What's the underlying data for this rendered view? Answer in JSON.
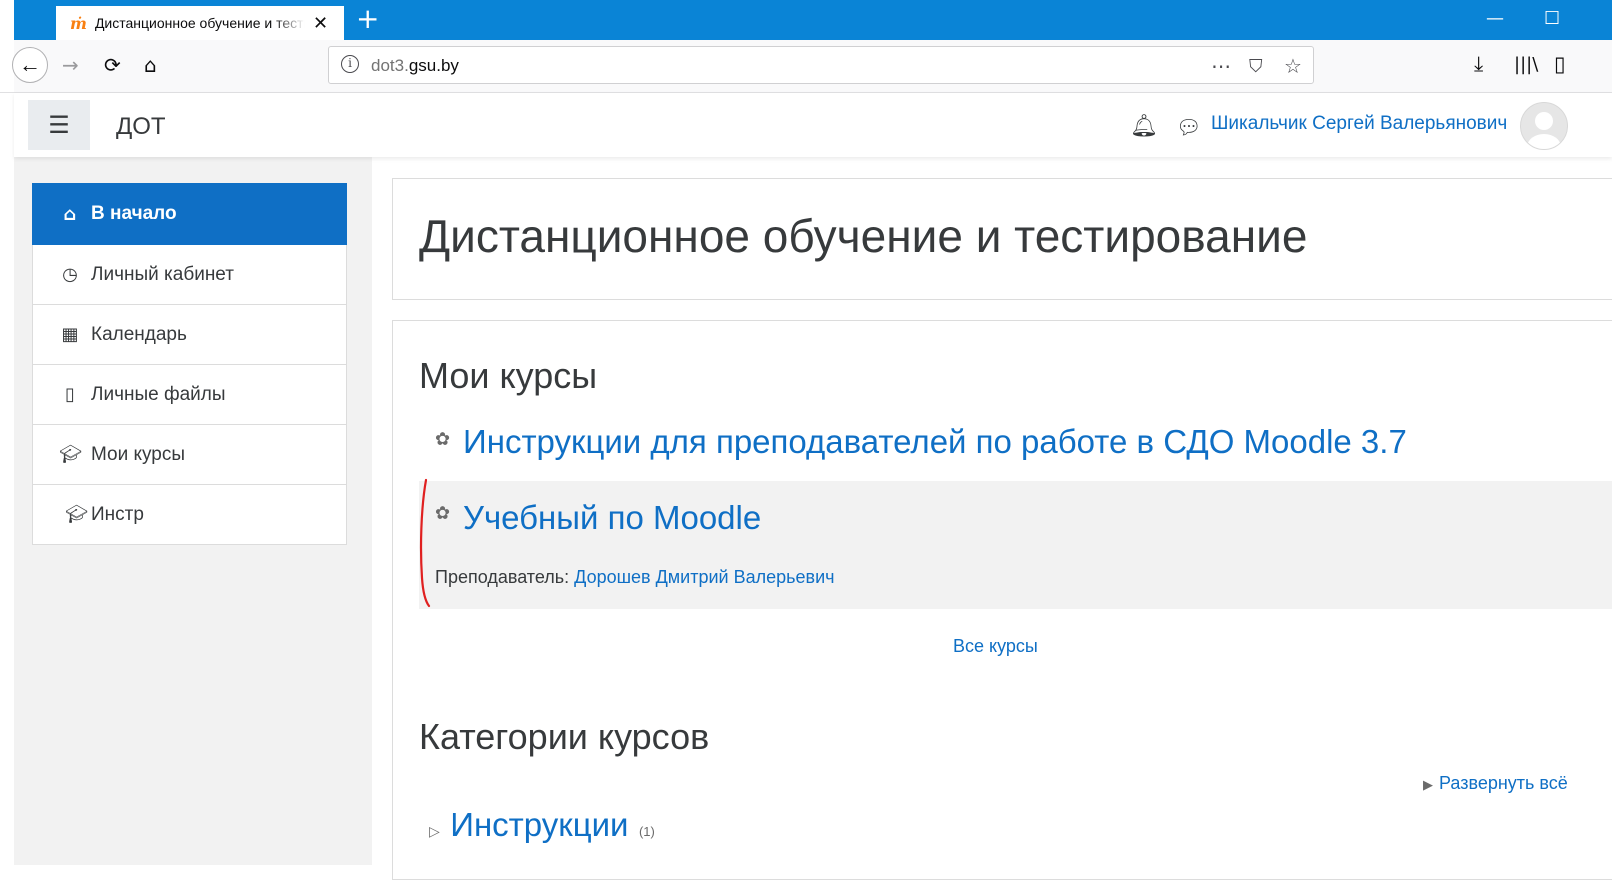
{
  "browser": {
    "tab_favicon": "ṁ",
    "tab_title": "Дистанционное обучение и тестирование",
    "new_tab": "+",
    "url_prefix": "dot3.",
    "url_domain": "gsu.by",
    "icons": [
      "back-icon",
      "forward-icon",
      "reload-icon",
      "home-icon",
      "info-icon",
      "more-icon",
      "pocket-icon",
      "star-icon",
      "download-icon",
      "library-icon",
      "reader-icon"
    ]
  },
  "header": {
    "menu_glyph": "☰",
    "brand": "ДОТ",
    "username": "Шикальчик Сергей Валерьянович"
  },
  "nav": {
    "items": [
      {
        "label": "В начало",
        "icon": "home-icon"
      },
      {
        "label": "Личный кабинет",
        "icon": "dashboard-icon"
      },
      {
        "label": "Календарь",
        "icon": "calendar-icon"
      },
      {
        "label": "Личные файлы",
        "icon": "file-icon"
      },
      {
        "label": "Мои курсы",
        "icon": "graduation-cap-icon"
      },
      {
        "label": "Инстр",
        "icon": "graduation-cap-icon"
      }
    ]
  },
  "main": {
    "page_title": "Дистанционное обучение и тестирование",
    "my_courses_heading": "Мои курсы",
    "courses": [
      {
        "name": "Инструкции для преподавателей по работе в СДО Moodle 3.7"
      },
      {
        "name": "Учебный по Moodle",
        "teacher_label": "Преподаватель:",
        "teacher_name": "Дорошев Дмитрий Валерьевич"
      }
    ],
    "all_courses": "Все курсы",
    "categories_heading": "Категории курсов",
    "expand_all": "Развернуть всё",
    "categories": [
      {
        "name": "Инструкции",
        "count": "(1)"
      }
    ]
  },
  "colors": {
    "browser_accent": "#0a84d6",
    "moodle_blue": "#0f6fc5",
    "annotation_red": "#e02020"
  }
}
